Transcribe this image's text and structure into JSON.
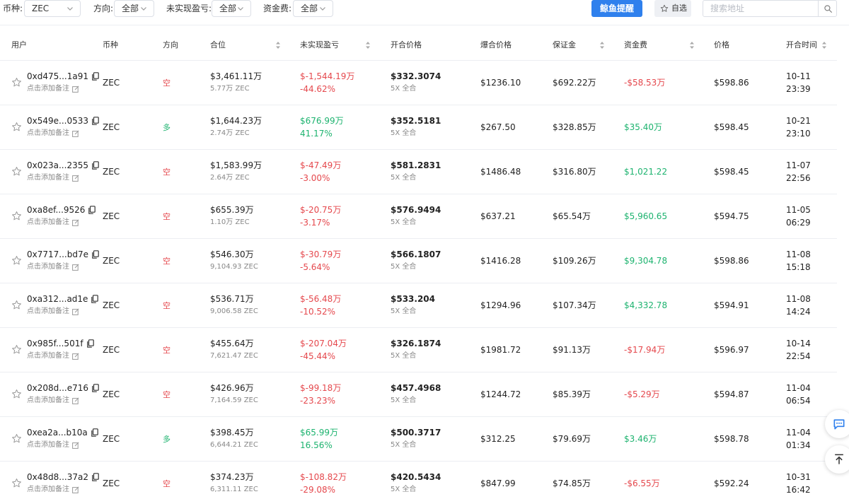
{
  "filters": {
    "coin_label": "币种:",
    "coin_value": "ZEC",
    "direction_label": "方向:",
    "direction_value": "全部",
    "pnl_label": "未实现盈亏:",
    "pnl_value": "全部",
    "funding_label": "资金费:",
    "funding_value": "全部",
    "alert_button": "鲸鱼提醒",
    "favorites_button": "自选",
    "search_placeholder": "搜索地址"
  },
  "table": {
    "headers": {
      "user": "用户",
      "coin": "币种",
      "direction": "方向",
      "position": "合位",
      "pnl": "未实现盈亏",
      "open_price": "开合价格",
      "liq_price": "爆合价格",
      "margin": "保证金",
      "funding": "资金费",
      "price": "价格",
      "open_time": "开合时间"
    },
    "rows": [
      {
        "address": "0xd475...1a91",
        "note": "点击添加备注",
        "coin": "ZEC",
        "direction": "空",
        "dir_type": "short",
        "position_value": "$3,461.11万",
        "position_size": "5.77万 ZEC",
        "pnl_value": "$-1,544.19万",
        "pnl_pct": "-44.62%",
        "pnl_type": "loss",
        "open_price": "$332.3074",
        "leverage": "5X 全合",
        "liq_price": "$1236.10",
        "margin": "$692.22万",
        "funding": "-$58.53万",
        "funding_type": "neg",
        "price": "$598.86",
        "date": "10-11",
        "time": "23:39"
      },
      {
        "address": "0x549e...0533",
        "note": "点击添加备注",
        "coin": "ZEC",
        "direction": "多",
        "dir_type": "long",
        "position_value": "$1,644.23万",
        "position_size": "2.74万 ZEC",
        "pnl_value": "$676.99万",
        "pnl_pct": "41.17%",
        "pnl_type": "profit",
        "open_price": "$352.5181",
        "leverage": "5X 全合",
        "liq_price": "$267.50",
        "margin": "$328.85万",
        "funding": "$35.40万",
        "funding_type": "pos",
        "price": "$598.45",
        "date": "10-21",
        "time": "23:10"
      },
      {
        "address": "0x023a...2355",
        "note": "点击添加备注",
        "coin": "ZEC",
        "direction": "空",
        "dir_type": "short",
        "position_value": "$1,583.99万",
        "position_size": "2.64万 ZEC",
        "pnl_value": "$-47.49万",
        "pnl_pct": "-3.00%",
        "pnl_type": "loss",
        "open_price": "$581.2831",
        "leverage": "5X 全合",
        "liq_price": "$1486.48",
        "margin": "$316.80万",
        "funding": "$1,021.22",
        "funding_type": "pos",
        "price": "$598.45",
        "date": "11-07",
        "time": "22:56"
      },
      {
        "address": "0xa8ef...9526",
        "note": "点击添加备注",
        "coin": "ZEC",
        "direction": "空",
        "dir_type": "short",
        "position_value": "$655.39万",
        "position_size": "1.10万 ZEC",
        "pnl_value": "$-20.75万",
        "pnl_pct": "-3.17%",
        "pnl_type": "loss",
        "open_price": "$576.9494",
        "leverage": "5X 全合",
        "liq_price": "$637.21",
        "margin": "$65.54万",
        "funding": "$5,960.65",
        "funding_type": "pos",
        "price": "$594.75",
        "date": "11-05",
        "time": "06:29"
      },
      {
        "address": "0x7717...bd7e",
        "note": "点击添加备注",
        "coin": "ZEC",
        "direction": "空",
        "dir_type": "short",
        "position_value": "$546.30万",
        "position_size": "9,104.93 ZEC",
        "pnl_value": "$-30.79万",
        "pnl_pct": "-5.64%",
        "pnl_type": "loss",
        "open_price": "$566.1807",
        "leverage": "5X 全合",
        "liq_price": "$1416.28",
        "margin": "$109.26万",
        "funding": "$9,304.78",
        "funding_type": "pos",
        "price": "$598.86",
        "date": "11-08",
        "time": "15:18"
      },
      {
        "address": "0xa312...ad1e",
        "note": "点击添加备注",
        "coin": "ZEC",
        "direction": "空",
        "dir_type": "short",
        "position_value": "$536.71万",
        "position_size": "9,006.58 ZEC",
        "pnl_value": "$-56.48万",
        "pnl_pct": "-10.52%",
        "pnl_type": "loss",
        "open_price": "$533.204",
        "leverage": "5X 全合",
        "liq_price": "$1294.96",
        "margin": "$107.34万",
        "funding": "$4,332.78",
        "funding_type": "pos",
        "price": "$594.91",
        "date": "11-08",
        "time": "14:24"
      },
      {
        "address": "0x985f...501f",
        "note": "点击添加备注",
        "coin": "ZEC",
        "direction": "空",
        "dir_type": "short",
        "position_value": "$455.64万",
        "position_size": "7,621.47 ZEC",
        "pnl_value": "$-207.04万",
        "pnl_pct": "-45.44%",
        "pnl_type": "loss",
        "open_price": "$326.1874",
        "leverage": "5X 全合",
        "liq_price": "$1981.72",
        "margin": "$91.13万",
        "funding": "-$17.94万",
        "funding_type": "neg",
        "price": "$596.97",
        "date": "10-14",
        "time": "22:54"
      },
      {
        "address": "0x208d...e716",
        "note": "点击添加备注",
        "coin": "ZEC",
        "direction": "空",
        "dir_type": "short",
        "position_value": "$426.96万",
        "position_size": "7,164.59 ZEC",
        "pnl_value": "$-99.18万",
        "pnl_pct": "-23.23%",
        "pnl_type": "loss",
        "open_price": "$457.4968",
        "leverage": "5X 全合",
        "liq_price": "$1244.72",
        "margin": "$85.39万",
        "funding": "-$5.29万",
        "funding_type": "neg",
        "price": "$594.87",
        "date": "11-04",
        "time": "06:54"
      },
      {
        "address": "0xea2a...b10a",
        "note": "点击添加备注",
        "coin": "ZEC",
        "direction": "多",
        "dir_type": "long",
        "position_value": "$398.45万",
        "position_size": "6,644.21 ZEC",
        "pnl_value": "$65.99万",
        "pnl_pct": "16.56%",
        "pnl_type": "profit",
        "open_price": "$500.3717",
        "leverage": "5X 全合",
        "liq_price": "$312.25",
        "margin": "$79.69万",
        "funding": "$3.46万",
        "funding_type": "pos",
        "price": "$598.78",
        "date": "11-04",
        "time": "01:34"
      },
      {
        "address": "0x48d8...37a2",
        "note": "点击添加备注",
        "coin": "ZEC",
        "direction": "空",
        "dir_type": "short",
        "position_value": "$374.23万",
        "position_size": "6,311.11 ZEC",
        "pnl_value": "$-108.82万",
        "pnl_pct": "-29.08%",
        "pnl_type": "loss",
        "open_price": "$420.5434",
        "leverage": "5X 全合",
        "liq_price": "$847.99",
        "margin": "$74.85万",
        "funding": "-$6.55万",
        "funding_type": "neg",
        "price": "$592.24",
        "date": "10-31",
        "time": "16:42"
      }
    ]
  },
  "colors": {
    "accent": "#2f80ed",
    "loss": "#e5484d",
    "profit": "#1db36f"
  },
  "icons": {
    "star": "star-icon",
    "copy": "copy-icon",
    "edit": "edit-icon",
    "search": "search-icon",
    "chevron": "chevron-down-icon",
    "sort": "sort-icon",
    "chat": "chat-icon",
    "top": "back-to-top-icon"
  }
}
